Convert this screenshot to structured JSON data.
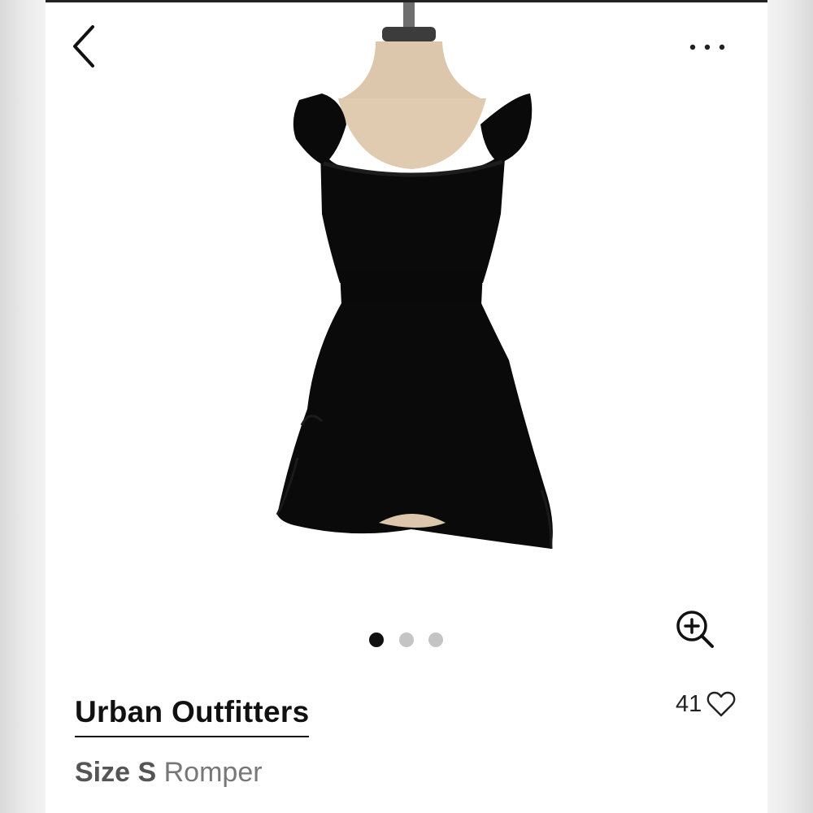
{
  "header": {
    "back_icon": "chevron-left-icon",
    "more_icon": "more-horizontal-icon"
  },
  "gallery": {
    "image_description": "black ruffled romper on dress form",
    "image_count": 3,
    "active_index": 0,
    "zoom_icon": "zoom-in-icon"
  },
  "listing": {
    "brand": "Urban Outfitters",
    "size_label": "Size S",
    "category": "Romper",
    "likes": "41",
    "like_icon": "heart-outline-icon"
  },
  "colors": {
    "background": "#ffffff",
    "text_primary": "#111111",
    "text_secondary": "#777777",
    "dot_active": "#111111",
    "dot_inactive": "#c4c4c4",
    "garment": "#0a0a0a"
  }
}
